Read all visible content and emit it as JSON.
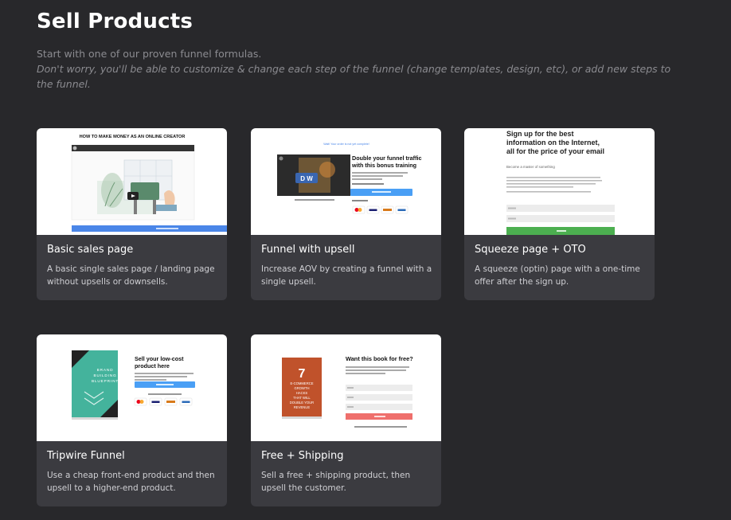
{
  "header": {
    "title": "Sell Products",
    "subtitle_line1": "Start with one of our proven funnel formulas.",
    "subtitle_line2": "Don't worry, you'll be able to customize & change each step of the funnel (change templates, design, etc), or add new steps to the funnel."
  },
  "cards": [
    {
      "title": "Basic sales page",
      "description": "A basic single sales page / landing page without upsells or downsells.",
      "thumb": {
        "headline": "HOW TO MAKE MONEY AS AN ONLINE CREATOR"
      }
    },
    {
      "title": "Funnel with upsell",
      "description": "Increase AOV by creating a funnel with a single upsell.",
      "thumb": {
        "top_link": "Wait! Your order is not yet complete!",
        "headline_1": "Double your funnel traffic",
        "headline_2": "with this bonus training",
        "video_text": "D  W"
      }
    },
    {
      "title": "Squeeze page + OTO",
      "description": "A squeeze (optin) page with a one-time offer after the sign up.",
      "thumb": {
        "headline_1": "Sign up for the best",
        "headline_2": "information on the Internet,",
        "headline_3": "all for the price of your email",
        "subhead": "Become a master of something"
      }
    },
    {
      "title": "Tripwire Funnel",
      "description": "Use a cheap front-end product and then upsell to a higher-end product.",
      "thumb": {
        "headline_1": "Sell your low-cost",
        "headline_2": "product here",
        "book_line_1": "BRAND",
        "book_line_2": "BUILDING",
        "book_line_3": "BLUEPRINT"
      }
    },
    {
      "title": "Free + Shipping",
      "description": "Sell a free + shipping product, then upsell the customer.",
      "thumb": {
        "headline": "Want this book for free?",
        "book_number": "7",
        "book_line_1": "E-COMMERCE",
        "book_line_2": "GROWTH",
        "book_line_3": "HACKS",
        "book_line_4": "THAT WILL",
        "book_line_5": "DOUBLE YOUR",
        "book_line_6": "REVENUE"
      }
    }
  ],
  "colors": {
    "background": "#28282b",
    "card": "#3b3b40",
    "subtitle": "#8b8b90",
    "blue_button": "#4a9ff5",
    "green_button": "#4caf50",
    "red_button": "#ef6f6c",
    "book_orange": "#c0522b",
    "book_teal": "#3aa893"
  }
}
